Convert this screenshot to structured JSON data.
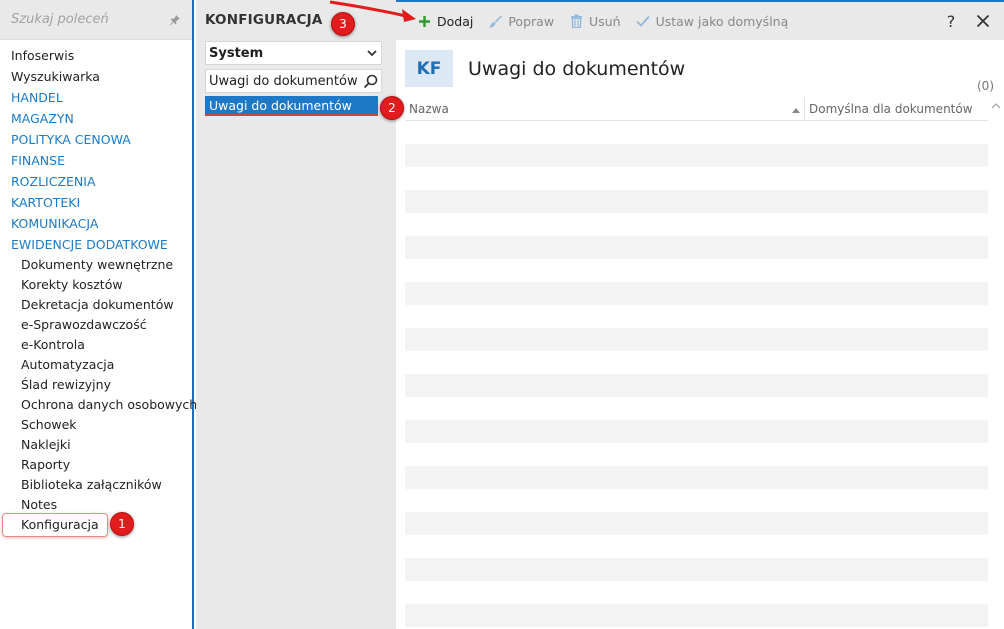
{
  "sidebar": {
    "search_placeholder": "Szukaj poleceń",
    "items": [
      {
        "label": "Infoserwis",
        "kind": "top"
      },
      {
        "label": "Wyszukiwarka",
        "kind": "top"
      },
      {
        "label": "HANDEL",
        "kind": "cat"
      },
      {
        "label": "MAGAZYN",
        "kind": "cat"
      },
      {
        "label": "POLITYKA CENOWA",
        "kind": "cat"
      },
      {
        "label": "FINANSE",
        "kind": "cat"
      },
      {
        "label": "ROZLICZENIA",
        "kind": "cat"
      },
      {
        "label": "KARTOTEKI",
        "kind": "cat"
      },
      {
        "label": "KOMUNIKACJA",
        "kind": "cat"
      },
      {
        "label": "EWIDENCJE DODATKOWE",
        "kind": "cat"
      },
      {
        "label": "Dokumenty wewnętrzne",
        "kind": "sub"
      },
      {
        "label": "Korekty kosztów",
        "kind": "sub"
      },
      {
        "label": "Dekretacja dokumentów",
        "kind": "sub"
      },
      {
        "label": "e-Sprawozdawczość",
        "kind": "sub"
      },
      {
        "label": "e-Kontrola",
        "kind": "sub"
      },
      {
        "label": "Automatyzacja",
        "kind": "sub"
      },
      {
        "label": "Ślad rewizyjny",
        "kind": "sub"
      },
      {
        "label": "Ochrona danych osobowych",
        "kind": "sub"
      },
      {
        "label": "Schowek",
        "kind": "sub"
      },
      {
        "label": "Naklejki",
        "kind": "sub"
      },
      {
        "label": "Raporty",
        "kind": "sub"
      },
      {
        "label": "Biblioteka załączników",
        "kind": "sub"
      },
      {
        "label": "Notes",
        "kind": "sub"
      },
      {
        "label": "Konfiguracja",
        "kind": "sub"
      }
    ]
  },
  "middle": {
    "title": "KONFIGURACJA",
    "module_select": "System",
    "filter_value": "Uwagi do dokumentów",
    "tree_selected": "Uwagi do dokumentów"
  },
  "toolbar": {
    "add_label": "Dodaj",
    "edit_label": "Popraw",
    "delete_label": "Usuń",
    "default_label": "Ustaw jako domyślną",
    "help_label": "?"
  },
  "main": {
    "badge": "KF",
    "title": "Uwagi do dokumentów",
    "count": "(0)",
    "columns": [
      "Nazwa",
      "Domyślna dla dokumentów"
    ]
  },
  "annotations": [
    "1",
    "2",
    "3"
  ],
  "colors": {
    "accent": "#1e78c8",
    "category_text": "#1b7ac7",
    "annotation_red": "#e21c1c",
    "add_green": "#2d9a2d"
  }
}
